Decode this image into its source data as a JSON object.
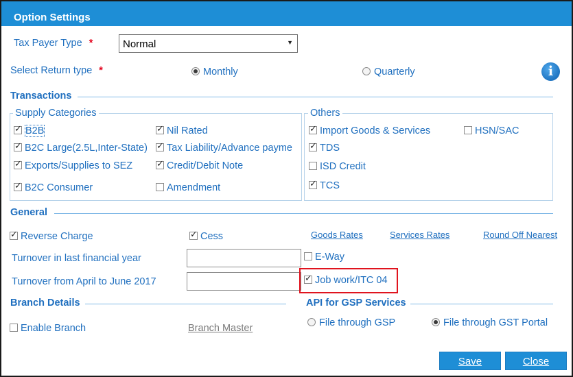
{
  "window": {
    "title": "Option Settings"
  },
  "tax_payer_type": {
    "label": "Tax Payer Type",
    "required": "*",
    "value": "Normal"
  },
  "return_type": {
    "label": "Select Return type",
    "required": "*",
    "options": [
      {
        "label": "Monthly",
        "selected": true
      },
      {
        "label": "Quarterly",
        "selected": false
      }
    ]
  },
  "info_icon": "i",
  "transactions": {
    "title": "Transactions",
    "supply_categories": {
      "legend": "Supply Categories",
      "items": [
        {
          "label": "B2B",
          "checked": true
        },
        {
          "label": "Nil Rated",
          "checked": true
        },
        {
          "label": "B2C Large(2.5L,Inter-State)",
          "checked": true
        },
        {
          "label": "Tax Liability/Advance payme",
          "checked": true
        },
        {
          "label": "Exports/Supplies to SEZ",
          "checked": true
        },
        {
          "label": "Credit/Debit Note",
          "checked": true
        },
        {
          "label": "B2C Consumer",
          "checked": true
        },
        {
          "label": "Amendment",
          "checked": false
        }
      ]
    },
    "others": {
      "legend": "Others",
      "items": [
        {
          "label": "Import Goods & Services",
          "checked": true
        },
        {
          "label": "HSN/SAC",
          "checked": false
        },
        {
          "label": "TDS",
          "checked": true
        },
        {
          "label": "ISD Credit",
          "checked": false
        },
        {
          "label": "TCS",
          "checked": true
        }
      ]
    }
  },
  "general": {
    "title": "General",
    "reverse_charge": {
      "label": "Reverse Charge",
      "checked": true
    },
    "cess": {
      "label": "Cess",
      "checked": true
    },
    "links": [
      "Goods Rates",
      "Services Rates",
      "Round Off Nearest"
    ],
    "turnover_last_year": {
      "label": "Turnover in last financial year",
      "value": ""
    },
    "turnover_april_june": {
      "label": "Turnover from April to June 2017",
      "value": ""
    },
    "eway": {
      "label": "E-Way",
      "checked": false
    },
    "job_work": {
      "label": "Job work/ITC 04",
      "checked": true
    }
  },
  "branch": {
    "title": "Branch Details",
    "enable_branch": {
      "label": "Enable Branch",
      "checked": false
    },
    "branch_master_link": "Branch Master"
  },
  "api": {
    "title": "API for GSP Services",
    "options": [
      {
        "label": "File through GSP",
        "selected": false
      },
      {
        "label": "File through GST Portal",
        "selected": true
      }
    ]
  },
  "buttons": {
    "save": "Save",
    "close": "Close"
  },
  "colors": {
    "accent": "#1e8ed6",
    "text": "#1f6fbf",
    "highlight": "#e0141e"
  }
}
